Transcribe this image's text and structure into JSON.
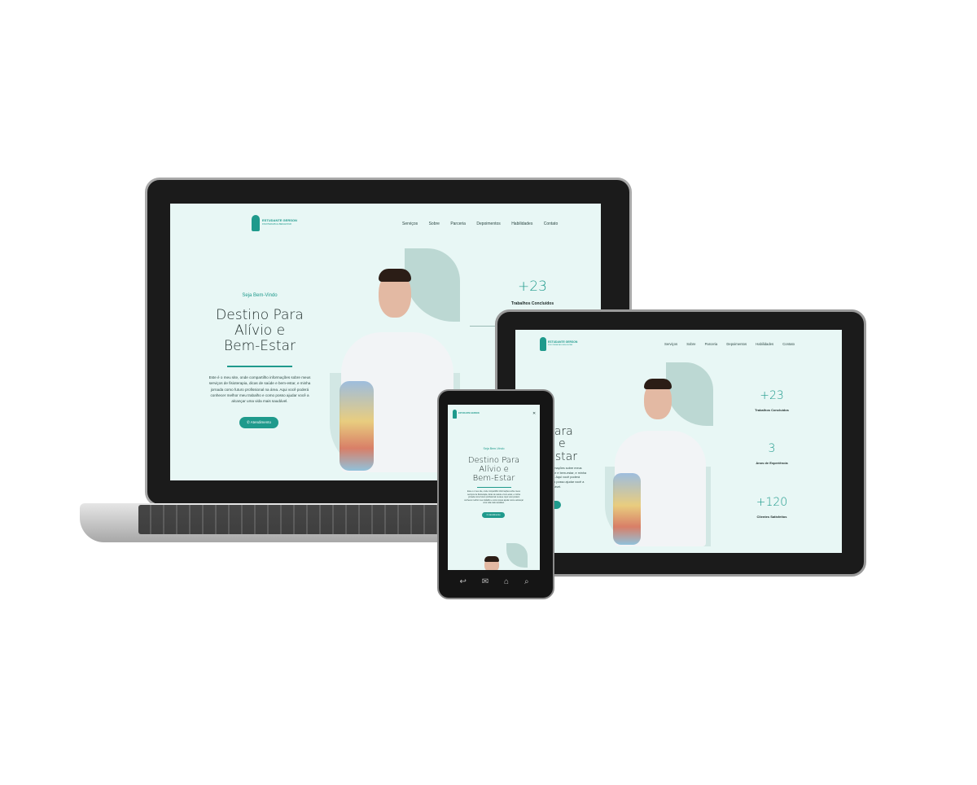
{
  "site": {
    "brand_name": "ESTUDANTE GERSON",
    "brand_tagline": "FISIOTERAPIA E BEM-ESTAR",
    "nav": [
      "Serviços",
      "Sobre",
      "Parceria",
      "Depoimentos",
      "Habilidades",
      "Contato"
    ],
    "welcome": "Seja Bem-Vindo",
    "hero_title_lines": [
      "Destino Para",
      "Alívio e",
      "Bem-Estar"
    ],
    "hero_text": "Este é o meu site, onde compartilho informações sobre meus serviços de fisioterapia, dicas de saúde e bem-estar, e minha jornada como futuro profissional na área. Aqui você poderá conhecer melhor meu trabalho e como posso ajudar você a alcançar uma vida mais saudável.",
    "cta_label": "Atendimento",
    "stats": [
      {
        "value": "+23",
        "label": "Trabalhos Concluídos"
      },
      {
        "value": "3",
        "label": "Anos de Experiência"
      },
      {
        "value": "+120",
        "label": "Clientes Satisfeitos"
      }
    ],
    "tablet_partial_title": [
      "o Para",
      "o e",
      "Estar"
    ],
    "tablet_partial_text": "informações sobre meus saúde e bem-estar, e minha área. Aqui você poderá como posso ajudar você a saudável."
  },
  "colors": {
    "accent": "#1f9a8c",
    "screen_bg": "#e8f7f5",
    "device_frame": "#1a1a1a"
  },
  "icons": {
    "phone": "phone-icon",
    "menu": "menu-icon",
    "back": "back-icon",
    "mail": "mail-icon",
    "home": "home-icon",
    "search": "search-icon"
  }
}
